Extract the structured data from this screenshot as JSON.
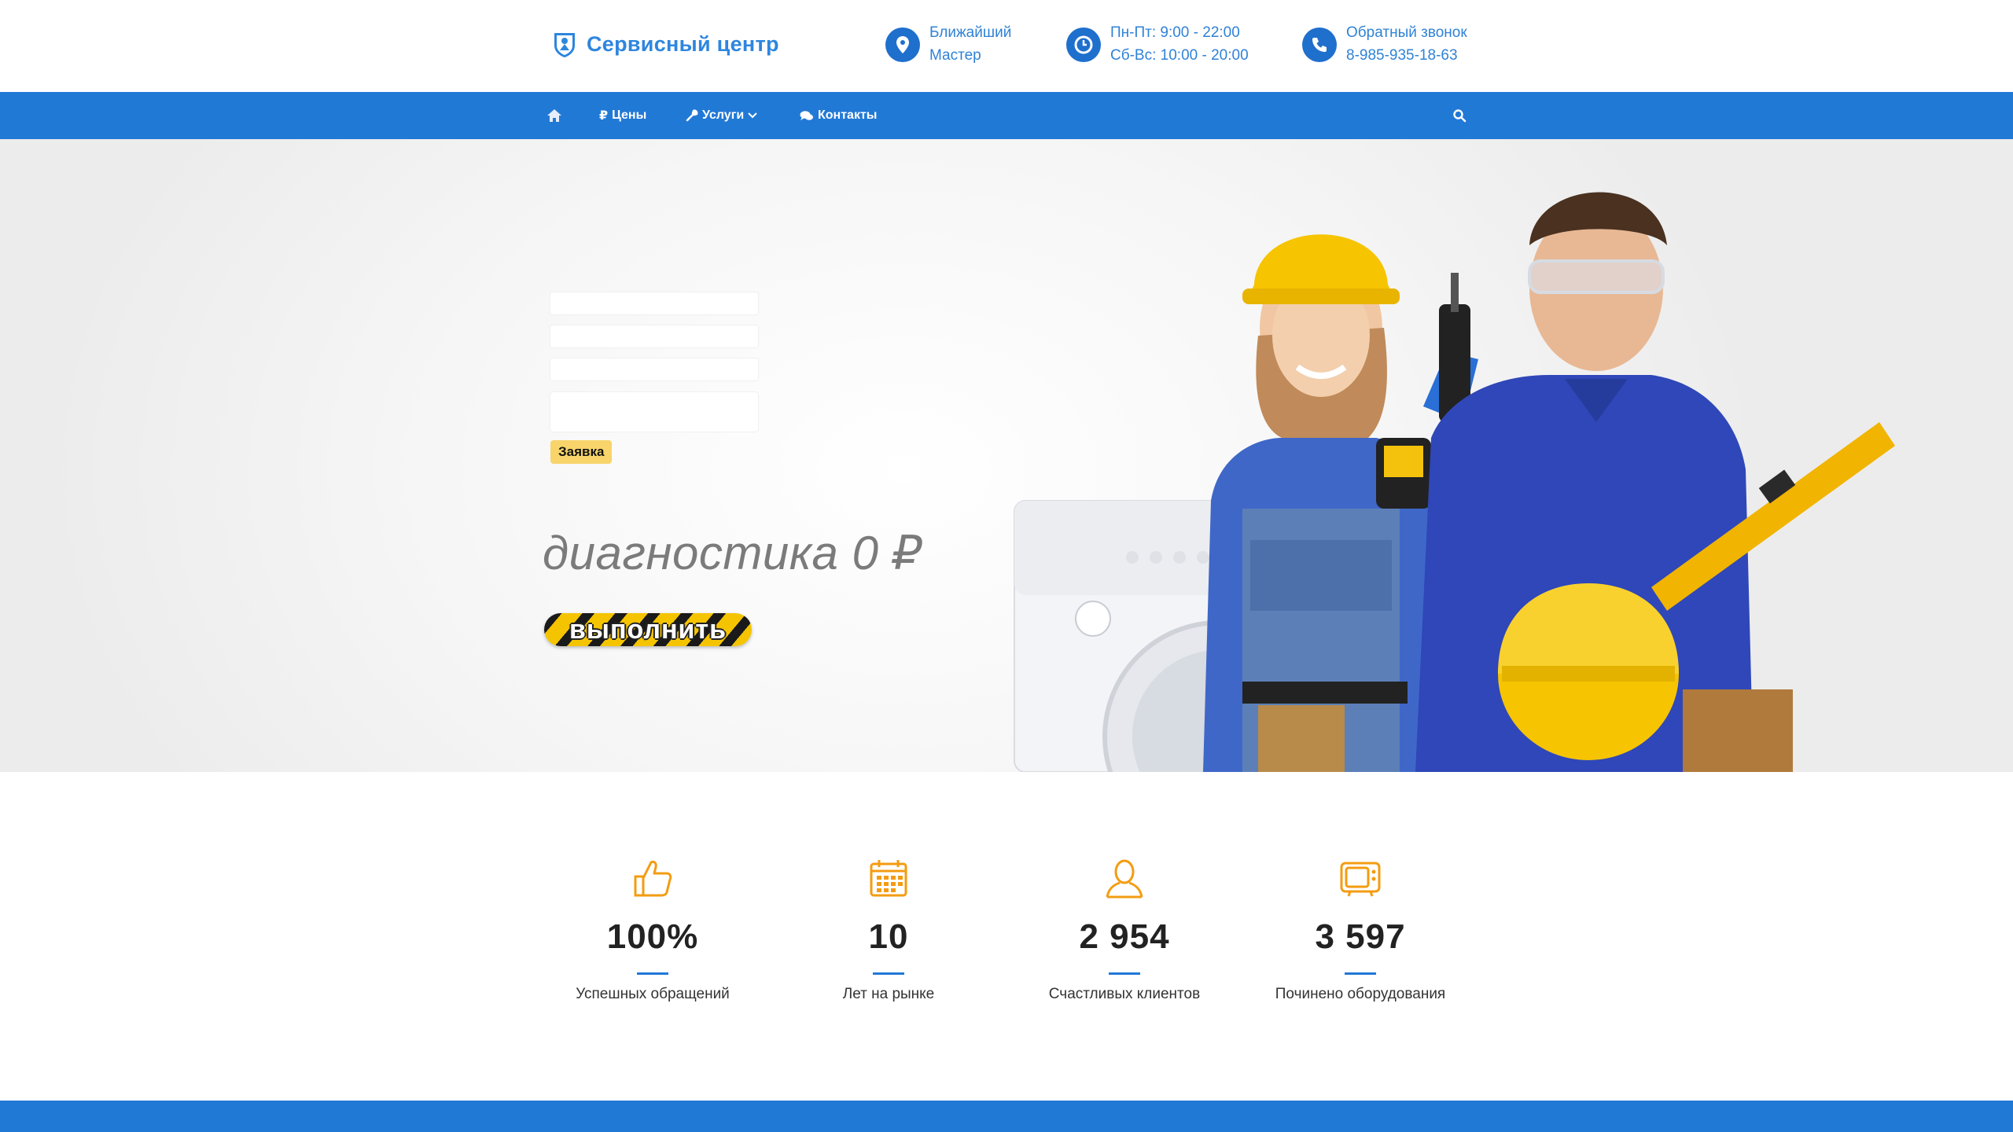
{
  "header": {
    "logo_text": "Сервисный центр",
    "master": {
      "line1": "Ближайший",
      "line2": "Мастер"
    },
    "hours": {
      "line1": "Пн-Пт: 9:00 - 22:00",
      "line2": "Сб-Вс: 10:00 - 20:00"
    },
    "callback": {
      "line1": "Обратный звонок",
      "line2": "8-985-935-18-63"
    }
  },
  "nav": {
    "home_icon": "home-icon",
    "prices": "Цены",
    "services": "Услуги",
    "contacts": "Контакты",
    "search_icon": "search-icon"
  },
  "hero": {
    "submit_label": "Заявка",
    "title": "диагностика 0 ₽",
    "cta_label": "выполнить",
    "slides_total": 3,
    "active_slide": 1
  },
  "stats": [
    {
      "icon": "thumbs-up-icon",
      "value": "100%",
      "label": "Успешных обращений"
    },
    {
      "icon": "calendar-icon",
      "value": "10",
      "label": "Лет на рынке"
    },
    {
      "icon": "user-icon",
      "value": "2 954",
      "label": "Счастливых клиентов"
    },
    {
      "icon": "tv-icon",
      "value": "3 597",
      "label": "Починено оборудования"
    }
  ],
  "colors": {
    "brand_blue": "#2179d6",
    "accent_orange": "#f39c12",
    "accent_yellow": "#f5c400"
  }
}
